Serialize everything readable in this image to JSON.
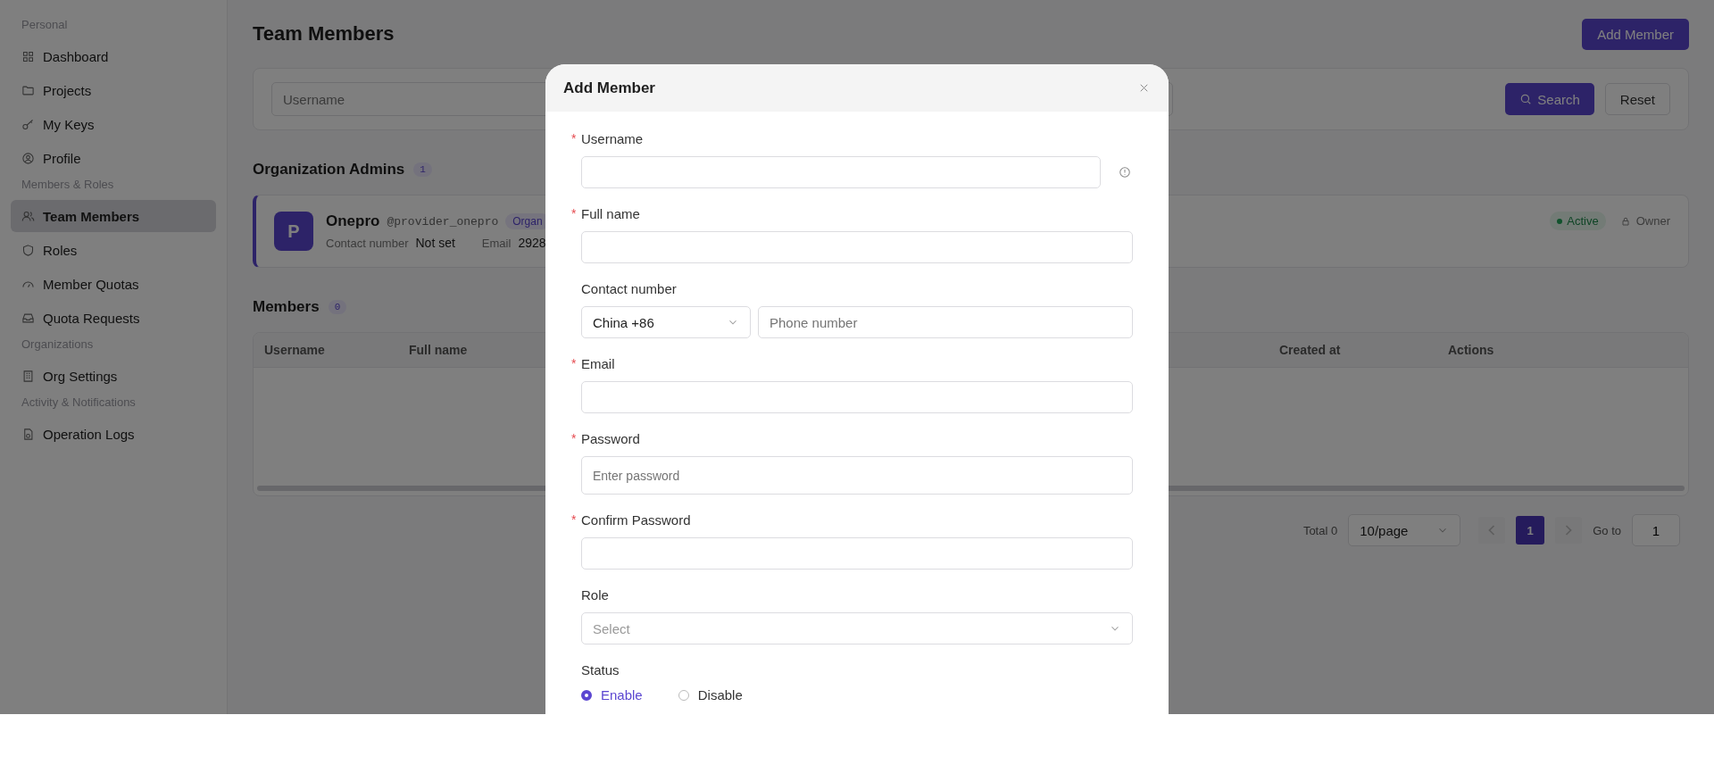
{
  "sidebar": {
    "sections": [
      {
        "title": "Personal",
        "items": [
          {
            "label": "Dashboard",
            "selected": false
          },
          {
            "label": "Projects",
            "selected": false
          },
          {
            "label": "My Keys",
            "selected": false
          },
          {
            "label": "Profile",
            "selected": false
          }
        ]
      },
      {
        "title": "Members & Roles",
        "items": [
          {
            "label": "Team Members",
            "selected": true
          },
          {
            "label": "Roles",
            "selected": false
          },
          {
            "label": "Member Quotas",
            "selected": false
          },
          {
            "label": "Quota Requests",
            "selected": false
          }
        ]
      },
      {
        "title": "Organizations",
        "items": [
          {
            "label": "Org Settings",
            "selected": false
          }
        ]
      },
      {
        "title": "Activity & Notifications",
        "items": [
          {
            "label": "Operation Logs",
            "selected": false
          }
        ]
      }
    ]
  },
  "page": {
    "title": "Team Members",
    "add_button": "Add Member"
  },
  "filter": {
    "placeholder": "Username",
    "search_button": "Search",
    "reset_button": "Reset"
  },
  "admins": {
    "title": "Organization Admins",
    "count": "1",
    "cards": [
      {
        "initial": "P",
        "name": "Onepro",
        "handle": "@provider_onepro",
        "tag": "Organ",
        "contact_label": "Contact number",
        "contact_value": "Not set",
        "email_label": "Email",
        "email_value": "2928",
        "status": "Active",
        "role": "Owner"
      }
    ]
  },
  "members": {
    "title": "Members",
    "count": "0",
    "columns": [
      "Username",
      "Full name",
      "Created at",
      "Actions"
    ]
  },
  "pagination": {
    "total": "Total 0",
    "page_size": "10/page",
    "pages": [
      {
        "label": "1",
        "selected": true
      }
    ],
    "goto_label": "Go to",
    "goto_value": "1"
  },
  "modal": {
    "title": "Add Member",
    "required_mark": "*",
    "fields": [
      {
        "kind": "text",
        "label": "Username",
        "required": true,
        "hint_icon": true
      },
      {
        "kind": "text",
        "label": "Full name",
        "required": true,
        "hint_icon": false
      },
      {
        "kind": "phone",
        "label": "Contact number",
        "required": false,
        "country": "China +86",
        "placeholder": "Phone number"
      },
      {
        "kind": "text",
        "label": "Email",
        "required": true,
        "hint_icon": false
      },
      {
        "kind": "password",
        "label": "Password",
        "required": true,
        "placeholder": "Enter password"
      },
      {
        "kind": "text",
        "label": "Confirm Password",
        "required": true,
        "hint_icon": false
      },
      {
        "kind": "select",
        "label": "Role",
        "required": false,
        "placeholder": "Select"
      },
      {
        "kind": "radio",
        "label": "Status",
        "required": false,
        "options": [
          {
            "label": "Enable",
            "selected": true
          },
          {
            "label": "Disable",
            "selected": false
          }
        ]
      }
    ]
  }
}
